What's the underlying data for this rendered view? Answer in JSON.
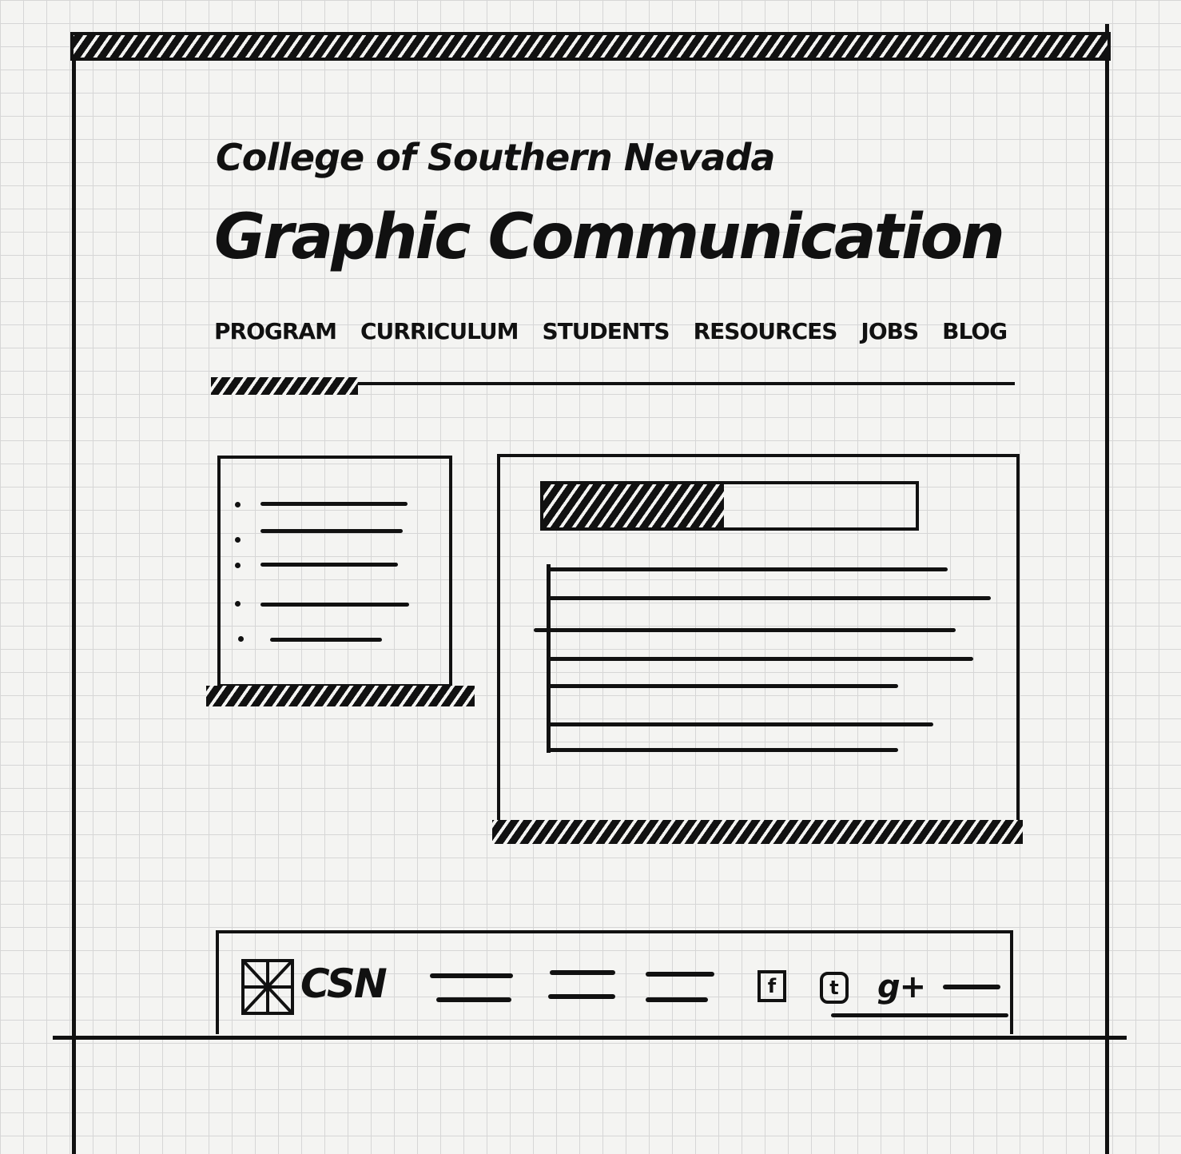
{
  "header": {
    "college_name": "College of Southern Nevada",
    "site_title": "Graphic Communication"
  },
  "nav": {
    "items": [
      {
        "label": "PROGRAM"
      },
      {
        "label": "CURRICULUM"
      },
      {
        "label": "STUDENTS"
      },
      {
        "label": "RESOURCES"
      },
      {
        "label": "JOBS"
      },
      {
        "label": "BLOG"
      }
    ]
  },
  "footer": {
    "logo_text": "CSN",
    "social": [
      "facebook-icon",
      "twitter-icon",
      "google-plus-icon"
    ],
    "gplus_label": "g+"
  }
}
